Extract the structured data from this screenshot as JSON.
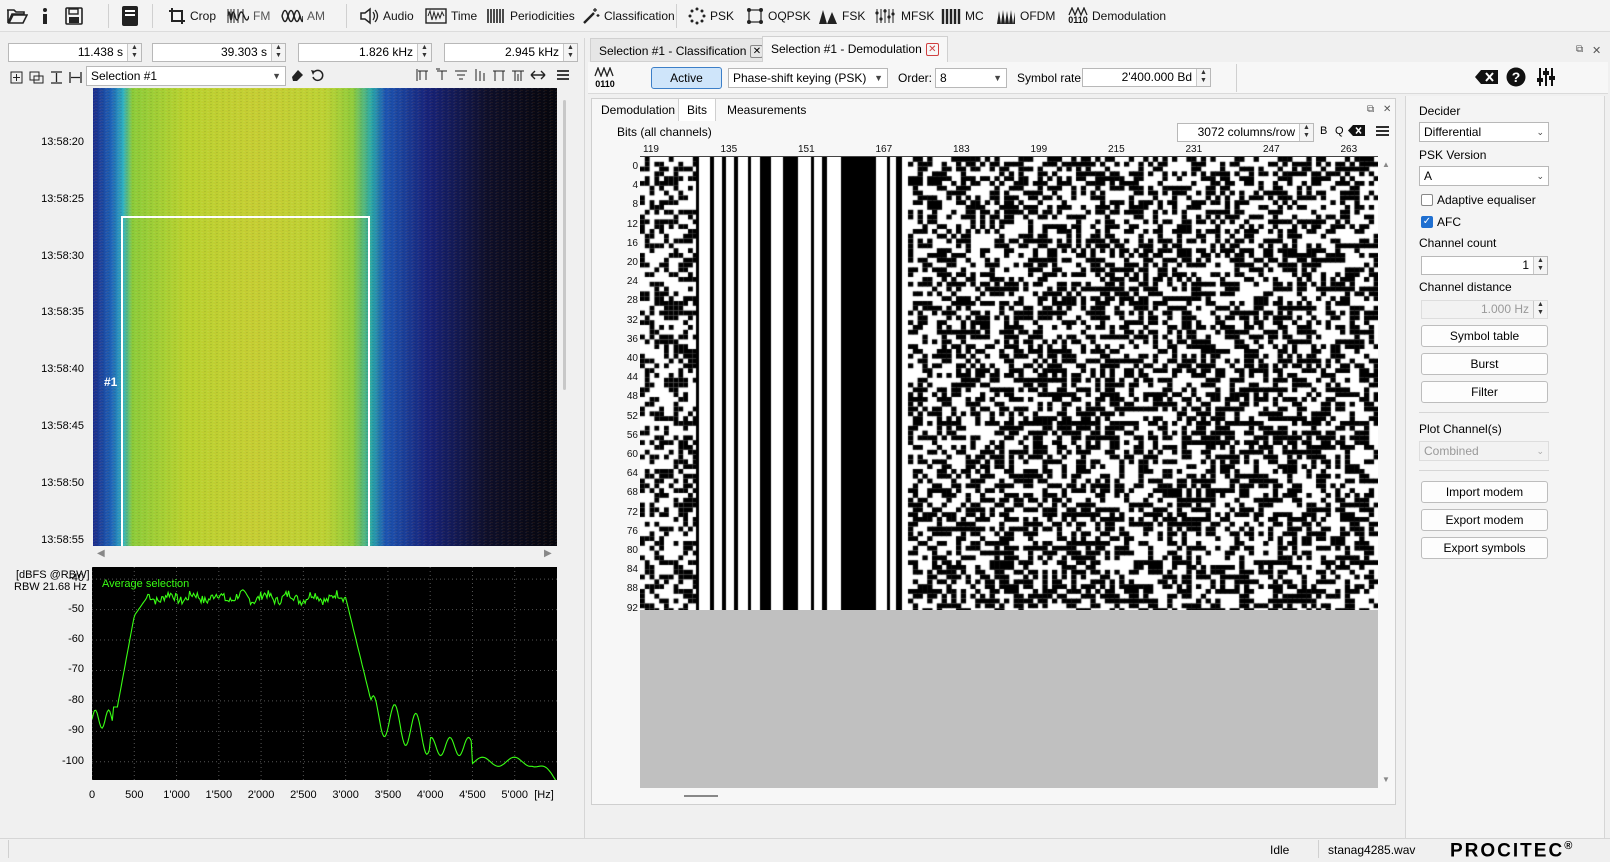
{
  "toolbar": {
    "open_icon": "folder-open-icon",
    "info_icon": "info-icon",
    "save_icon": "save-icon",
    "book_icon": "book-icon",
    "crop": "Crop",
    "fm": "FM",
    "am": "AM",
    "audio": "Audio",
    "time": "Time",
    "periodicities": "Periodicities",
    "classification": "Classification",
    "psk": "PSK",
    "oqpsk": "OQPSK",
    "fsk": "FSK",
    "mfsk": "MFSK",
    "mc": "MC",
    "ofdm": "OFDM",
    "demod_icon_text": "0110",
    "demodulation": "Demodulation"
  },
  "selection": {
    "t_start": "11.438 s",
    "t_end": "39.303 s",
    "f_low": "1.826 kHz",
    "f_high": "2.945 kHz",
    "name": "Selection #1",
    "marker": "#1"
  },
  "spectrogram": {
    "time_labels": [
      "13:58:20",
      "13:58:25",
      "13:58:30",
      "13:58:35",
      "13:58:40",
      "13:58:45",
      "13:58:50",
      "13:58:55"
    ]
  },
  "spectrum": {
    "unit": "[dBFS @RBW]",
    "rbw": "RBW 21.68 Hz",
    "legend": "Average selection",
    "y_ticks": [
      "-40",
      "-50",
      "-60",
      "-70",
      "-80",
      "-90",
      "-100"
    ],
    "x_ticks": [
      "0",
      "500",
      "1'000",
      "1'500",
      "2'000",
      "2'500",
      "3'000",
      "3'500",
      "4'000",
      "4'500",
      "5'000",
      "[Hz]"
    ],
    "line_color": "#39ff14"
  },
  "tabs": {
    "classification": "Selection #1 - Classification",
    "demodulation": "Selection #1 - Demodulation"
  },
  "demod": {
    "icon_text": "0110",
    "active": "Active",
    "mode": "Phase-shift keying (PSK)",
    "order_label": "Order:",
    "order": "8",
    "rate_label": "Symbol rate:",
    "rate": "2'400.000 Bd"
  },
  "subtabs": {
    "demodulation": "Demodulation",
    "bits": "Bits",
    "measurements": "Measurements"
  },
  "bits": {
    "title": "Bits (all channels)",
    "columns": "3072 columns/row",
    "b": "B",
    "q": "Q",
    "col_labels": [
      "119",
      "135",
      "151",
      "167",
      "183",
      "199",
      "215",
      "231",
      "247",
      "263"
    ],
    "row_labels": [
      "0",
      "4",
      "8",
      "12",
      "16",
      "20",
      "24",
      "28",
      "32",
      "36",
      "40",
      "44",
      "48",
      "52",
      "56",
      "60",
      "64",
      "68",
      "72",
      "76",
      "80",
      "84",
      "88",
      "92"
    ]
  },
  "settings": {
    "decider_label": "Decider",
    "decider": "Differential",
    "psk_version_label": "PSK Version",
    "psk_version": "A",
    "adaptive_eq": "Adaptive equaliser",
    "afc": "AFC",
    "channel_count_label": "Channel count",
    "channel_count": "1",
    "channel_distance_label": "Channel distance",
    "channel_distance": "1.000 Hz",
    "symbol_table": "Symbol table",
    "burst": "Burst",
    "filter": "Filter",
    "plot_channel_label": "Plot Channel(s)",
    "plot_channel": "Combined",
    "import_modem": "Import modem",
    "export_modem": "Export modem",
    "export_symbols": "Export symbols"
  },
  "status": {
    "state": "Idle",
    "file": "stanag4285.wav",
    "brand": "PROCITEC",
    "reg": "®"
  }
}
